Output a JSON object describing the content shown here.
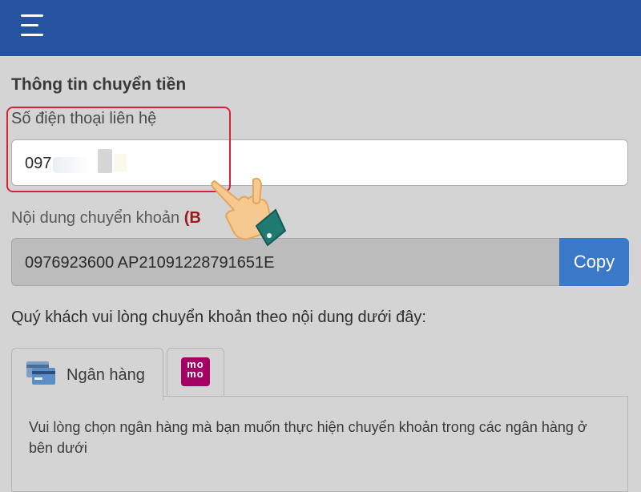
{
  "header": {
    "menu_icon": "hamburger-menu-icon",
    "color": "#2553a0"
  },
  "form": {
    "section_title": "Thông tin chuyển tiền",
    "phone_label": "Số điện thoại liên hệ",
    "phone_value": "097",
    "content_label": "Nội dung chuyển khoản",
    "content_label_emphasis": "(B",
    "content_value": "0976923600 AP21091228791651E",
    "copy_label": "Copy",
    "instruction": "Quý khách vui lòng chuyển khoản theo nội dung dưới đây:"
  },
  "tabs": [
    {
      "label": "Ngân hàng",
      "icon": "bank-card-icon"
    },
    {
      "label": "",
      "icon": "momo-logo-icon",
      "logo_text": "mo mo"
    }
  ],
  "panel": {
    "text": "Vui lòng chọn ngân hàng mà bạn muốn thực hiện chuyển khoản trong các ngân hàng ở bên dưới"
  },
  "colors": {
    "header": "#2553a0",
    "copy_button": "#3a78c8",
    "highlight": "#d9223a",
    "momo": "#a50064",
    "emphasis": "#9b1b1b"
  }
}
